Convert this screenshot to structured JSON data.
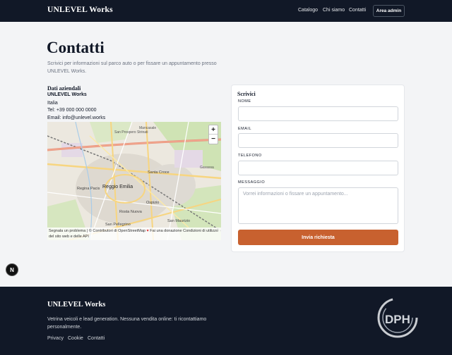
{
  "header": {
    "brand": "UNLEVEL Works",
    "nav": {
      "catalogo": "Catalogo",
      "chi_siamo": "Chi siamo",
      "contatti": "Contatti"
    },
    "admin_button": "Area admin"
  },
  "main": {
    "title": "Contatti",
    "intro": "Scrivici per informazioni sul parco auto o per fissare un appuntamento presso UNLEVEL Works.",
    "company_info": {
      "heading": "Dati aziendali",
      "company": "UNLEVEL Works",
      "country": "Italia",
      "tel": "Tel: +39 000 000 0000",
      "email": "Email: info@unlevel.works"
    },
    "map": {
      "zoom_in": "+",
      "zoom_out": "−",
      "attribution_report": "Segnala un problema",
      "attribution_osm": "| © Contributori di OpenStreetMap",
      "attribution_donate": "Fai una donazione",
      "attribution_terms": "Condizioni di utilizzo del sito web e delle API",
      "labels": {
        "mancasale": "Mancasale",
        "san_prospero": "San Prospero Strinati",
        "santa_croce": "Santa Croce",
        "regina_pacis": "Regina Pacis",
        "reggio_emilia": "Reggio Emilia",
        "ospizio": "Ospizio",
        "rosta_nuova": "Rosta Nuova",
        "san_maurizio": "San Maurizio",
        "san_pellegrino": "San Pellegrino",
        "gavassa": "Gavassa"
      }
    },
    "form": {
      "title": "Scrivici",
      "name_label": "NOME",
      "email_label": "EMAIL",
      "phone_label": "TELEFONO",
      "message_label": "MESSAGGIO",
      "message_placeholder": "Vorrei informazioni o fissare un appuntamento...",
      "submit": "Invia richiesta"
    },
    "badge": "N"
  },
  "footer": {
    "brand": "UNLEVEL Works",
    "description": "Vetrina veicoli e lead generation. Nessuna vendita online: ti ricontattiamo personalmente.",
    "links": {
      "privacy": "Privacy",
      "cookie": "Cookie",
      "contatti": "Contatti"
    },
    "logo_text": "DPH"
  },
  "colors": {
    "dark": "#111827",
    "accent": "#c8612f",
    "background": "#f3f4f6"
  }
}
